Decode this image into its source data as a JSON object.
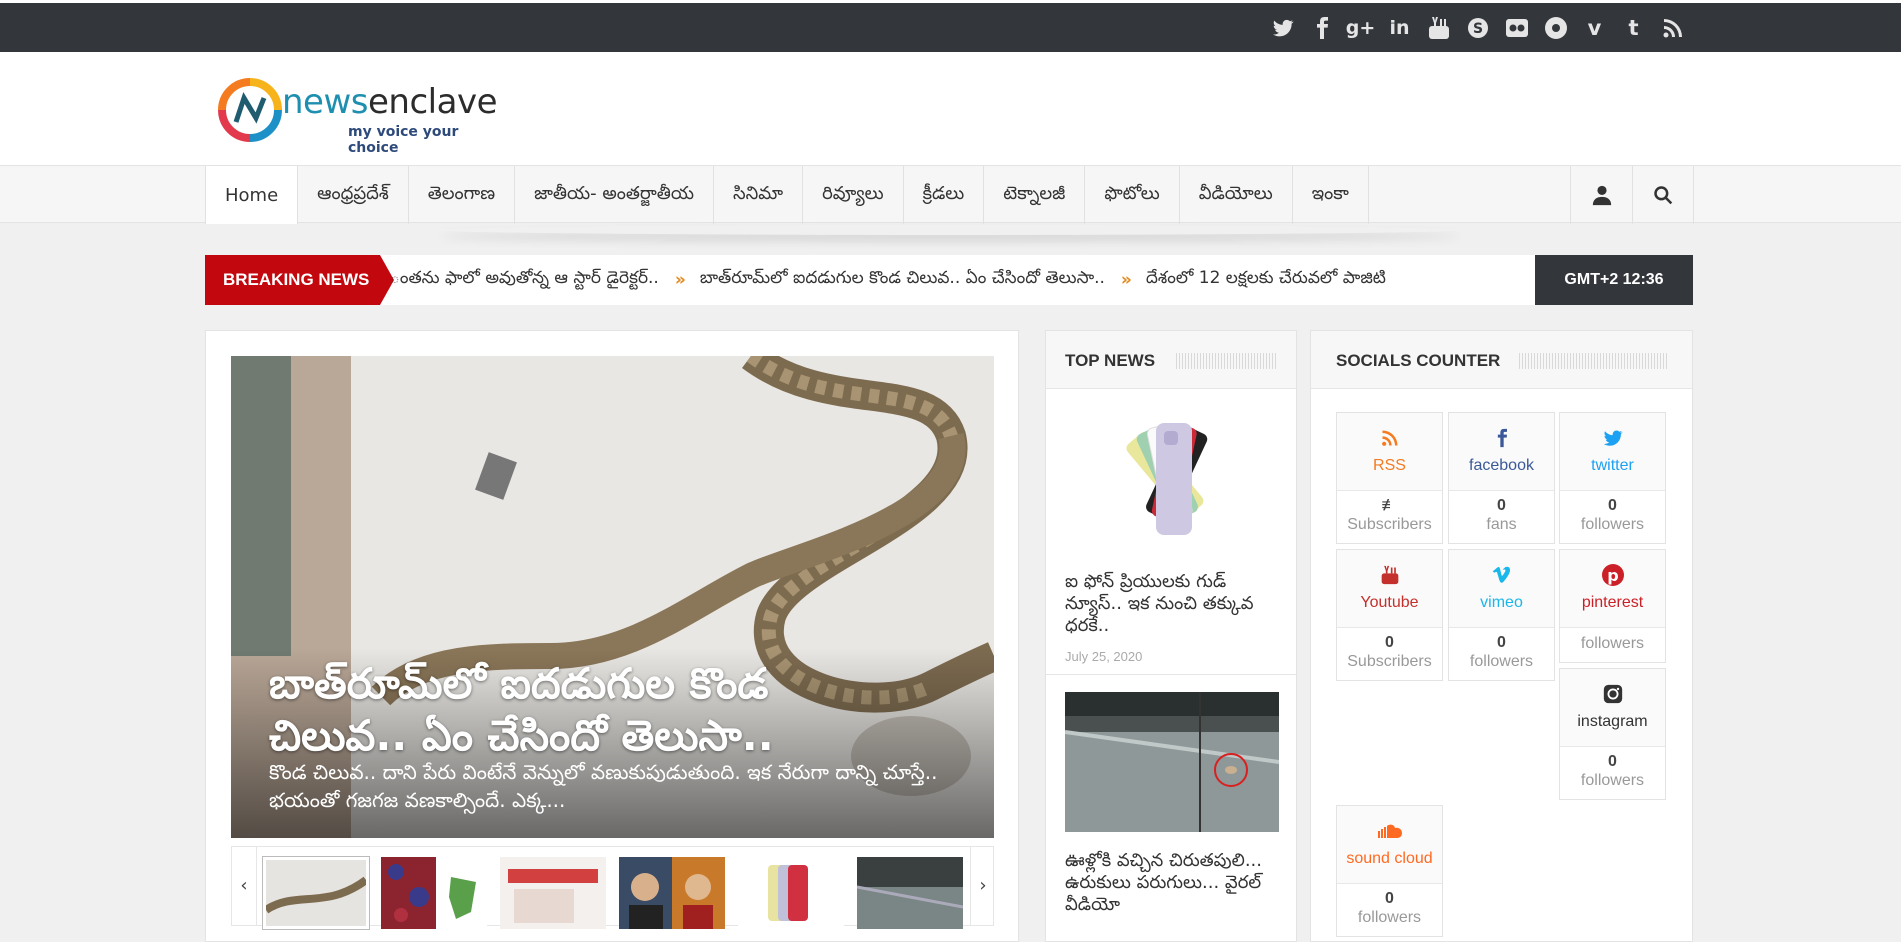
{
  "topbar": {
    "social_icons": [
      "twitter-icon",
      "facebook-icon",
      "google-plus-icon",
      "linkedin-icon",
      "youtube-icon",
      "skype-icon",
      "flickr-icon",
      "picasa-icon",
      "vimeo-icon",
      "tumblr-icon",
      "rss-icon"
    ]
  },
  "logo": {
    "name_part1": "news",
    "name_part2": "enclave",
    "tagline": "my voice your choice"
  },
  "nav": {
    "items": [
      "Home",
      "ఆంధ్రప్రదేశ్",
      "తెలంగాణ",
      "జాతీయ- అంతర్జాతీయ",
      "సినిమా",
      "రివ్యూలు",
      "క్రీడలు",
      "టెక్నాలజీ",
      "ఫొటోలు",
      "వీడియోలు",
      "ఇంకా"
    ],
    "active": "Home"
  },
  "breaking": {
    "label": "BREAKING NEWS",
    "items": [
      "ంతను ఫాలో అవుతోన్న ఆ స్టార్ డైరెక్టర్..",
      "బాత్‌రూమ్‌లో ఐదడుగుల కొండ చిలువ.. ఏం చేసిందో తెలుసా..",
      "దేశంలో 12 లక్షలకు చేరువలో పాజిటి"
    ],
    "clock": "GMT+2 12:36"
  },
  "slider": {
    "title": "బాత్‌రూమ్‌లో ఐదడుగుల కొండ చిలువ.. ఏం చేసిందో తెలుసా..",
    "excerpt": "కొండ చిలువ.. దాని పేరు వింటేనే వెన్నులో వణుకుపుడుతుంది. ఇక నేరుగా దాన్ని చూస్తే.. భయంతో గజగజ వణకాల్సిందే. ఎక్క..."
  },
  "top_news": {
    "heading": "TOP NEWS",
    "items": [
      {
        "title": "ఐ ఫోన్ ప్రియులకు గుడ్ న్యూస్.. ఇక నుంచి తక్కువ ధరకే..",
        "date": "July 25, 2020"
      },
      {
        "title": "ఊళ్లోకి వచ్చిన చిరుతపులి... ఉరుకులు పరుగులు... వైరల్ వీడియో",
        "date": ""
      }
    ]
  },
  "socials": {
    "heading": "SOCIALS COUNTER",
    "counters": [
      {
        "name": "RSS",
        "icon": "rss-icon",
        "count": "",
        "unit": "Subscribers",
        "color": "#f47b20"
      },
      {
        "name": "facebook",
        "icon": "facebook-icon",
        "count": "0",
        "unit": "fans",
        "color": "#3b5998"
      },
      {
        "name": "twitter",
        "icon": "twitter-icon",
        "count": "0",
        "unit": "followers",
        "color": "#1da1f2"
      },
      {
        "name": "Youtube",
        "icon": "youtube-icon",
        "count": "0",
        "unit": "Subscribers",
        "color": "#c4302b"
      },
      {
        "name": "vimeo",
        "icon": "vimeo-icon",
        "count": "0",
        "unit": "followers",
        "color": "#1ab7ea"
      },
      {
        "name": "pinterest",
        "icon": "pinterest-icon",
        "count": "",
        "unit": "followers",
        "color": "#cb2027"
      },
      {
        "name": "instagram",
        "icon": "instagram-icon",
        "count": "0",
        "unit": "followers",
        "color": "#333333"
      },
      {
        "name": "sound cloud",
        "icon": "soundcloud-icon",
        "count": "0",
        "unit": "followers",
        "color": "#ff6a22"
      }
    ]
  }
}
